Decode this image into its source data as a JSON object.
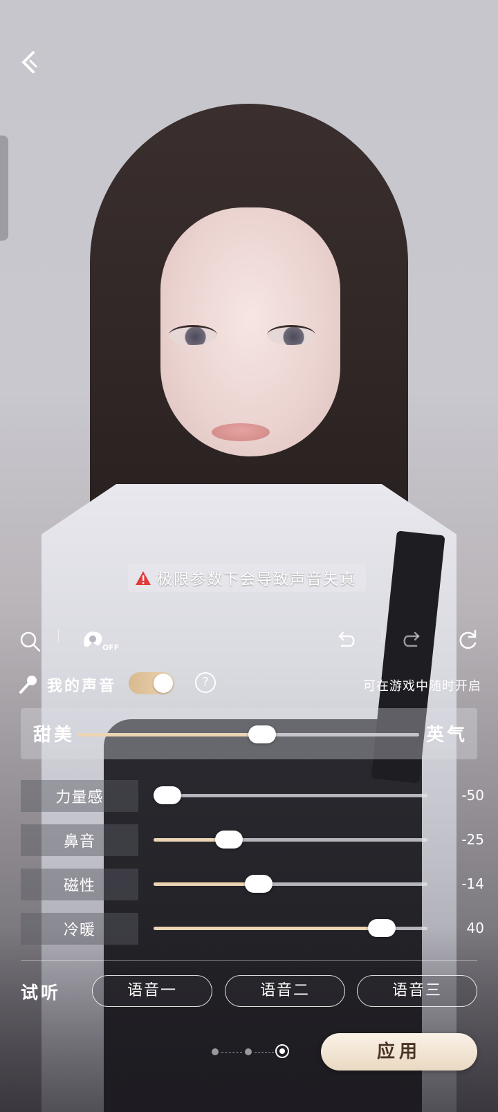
{
  "warning": {
    "text": "极限参数下会导致声音失真"
  },
  "toolbar": {
    "outfit_toggle_state": "OFF"
  },
  "voice": {
    "label": "我的声音",
    "toggle_on": true,
    "help_label": "?",
    "hint": "可在游戏中随时开启"
  },
  "style_slider": {
    "left_label": "甜美",
    "right_label": "英气",
    "value_fraction": 0.54
  },
  "params": [
    {
      "label": "力量感",
      "value": "-50",
      "fraction": 0.0
    },
    {
      "label": "鼻音",
      "value": "-25",
      "fraction": 0.25
    },
    {
      "label": "磁性",
      "value": "-14",
      "fraction": 0.37
    },
    {
      "label": "冷暖",
      "value": "40",
      "fraction": 0.87
    }
  ],
  "audition": {
    "label": "试听",
    "buttons": [
      "语音一",
      "语音二",
      "语音三"
    ]
  },
  "pager": {
    "current": 3,
    "total": 3
  },
  "apply_label": "应用",
  "colors": {
    "accent": "#ecd5b5",
    "button_text": "#4a3426"
  }
}
